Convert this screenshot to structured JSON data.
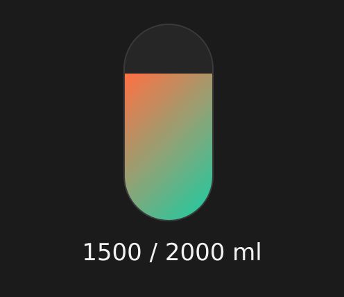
{
  "water_tracker": {
    "current_ml": 1500,
    "goal_ml": 2000,
    "fill_fraction": 0.75,
    "readout_text": "1500 / 2000 ml",
    "colors": {
      "background": "#1b1b1b",
      "tank": "#262626",
      "tank_border": "#3a3a3a",
      "fill_start": "#ff7043",
      "fill_end": "#17cda4",
      "text": "#f2f2f2"
    }
  }
}
